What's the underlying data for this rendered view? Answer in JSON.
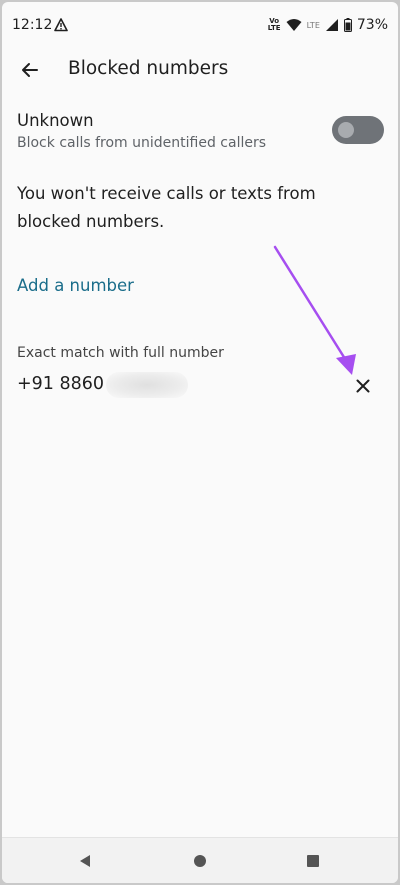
{
  "status_bar": {
    "time": "12:12",
    "alert_icon": "warning-triangle-icon",
    "volte_line1": "Vo",
    "volte_line2": "LTE",
    "lte_label": "LTE",
    "battery_percent": "73%"
  },
  "app_bar": {
    "title": "Blocked numbers",
    "back_icon": "arrow-back-icon"
  },
  "unknown": {
    "title": "Unknown",
    "subtitle": "Block calls from unidentified callers",
    "toggle_on": false
  },
  "info_text": "You won't receive calls or texts from blocked numbers.",
  "add_number_label": "Add a number",
  "blocked_list": {
    "section_label": "Exact match with full number",
    "items": [
      {
        "number": "+91 8860",
        "remove_icon": "close-icon"
      }
    ]
  },
  "colors": {
    "accent": "#1a6d8a",
    "annotation_arrow": "#a64ef0",
    "toggle_track": "#6f7378",
    "background": "#fafafa"
  },
  "nav_bar": {
    "back_icon": "triangle-back-icon",
    "home_icon": "circle-home-icon",
    "recents_icon": "square-recents-icon"
  }
}
